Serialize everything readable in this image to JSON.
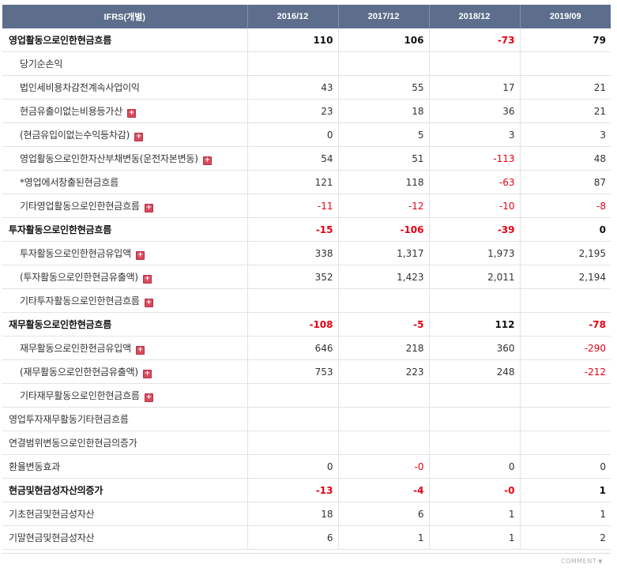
{
  "header": [
    "IFRS(개별)",
    "2016/12",
    "2017/12",
    "2018/12",
    "2019/09"
  ],
  "rows": [
    {
      "label": "영업활동으로인한현금흐름",
      "level": "major",
      "plus": false,
      "values": [
        "110",
        "106",
        "-73",
        "79"
      ]
    },
    {
      "label": "당기순손익",
      "level": "sub",
      "plus": false,
      "values": [
        "",
        "",
        "",
        ""
      ]
    },
    {
      "label": "법인세비용차감전계속사업이익",
      "level": "sub",
      "plus": false,
      "values": [
        "43",
        "55",
        "17",
        "21"
      ]
    },
    {
      "label": "현금유출이없는비용등가산",
      "level": "sub",
      "plus": true,
      "values": [
        "23",
        "18",
        "36",
        "21"
      ]
    },
    {
      "label": "(현금유입이없는수익등차감)",
      "level": "sub",
      "plus": true,
      "values": [
        "0",
        "5",
        "3",
        "3"
      ]
    },
    {
      "label": "영업활동으로인한자산부채변동(운전자본변동)",
      "level": "sub",
      "plus": true,
      "values": [
        "54",
        "51",
        "-113",
        "48"
      ]
    },
    {
      "label": "*영업에서창출된현금흐름",
      "level": "sub",
      "plus": false,
      "values": [
        "121",
        "118",
        "-63",
        "87"
      ]
    },
    {
      "label": "기타영업활동으로인한현금흐름",
      "level": "sub",
      "plus": true,
      "values": [
        "-11",
        "-12",
        "-10",
        "-8"
      ]
    },
    {
      "label": "투자활동으로인한현금흐름",
      "level": "major",
      "plus": false,
      "values": [
        "-15",
        "-106",
        "-39",
        "0"
      ]
    },
    {
      "label": "투자활동으로인한현금유입액",
      "level": "sub",
      "plus": true,
      "values": [
        "338",
        "1,317",
        "1,973",
        "2,195"
      ]
    },
    {
      "label": "(투자활동으로인한현금유출액)",
      "level": "sub",
      "plus": true,
      "values": [
        "352",
        "1,423",
        "2,011",
        "2,194"
      ]
    },
    {
      "label": "기타투자활동으로인한현금흐름",
      "level": "sub",
      "plus": true,
      "values": [
        "",
        "",
        "",
        ""
      ]
    },
    {
      "label": "재무활동으로인한현금흐름",
      "level": "major",
      "plus": false,
      "values": [
        "-108",
        "-5",
        "112",
        "-78"
      ]
    },
    {
      "label": "재무활동으로인한현금유입액",
      "level": "sub",
      "plus": true,
      "values": [
        "646",
        "218",
        "360",
        "-290"
      ]
    },
    {
      "label": "(재무활동으로인한현금유출액)",
      "level": "sub",
      "plus": true,
      "values": [
        "753",
        "223",
        "248",
        "-212"
      ]
    },
    {
      "label": "기타재무활동으로인한현금흐름",
      "level": "sub",
      "plus": true,
      "values": [
        "",
        "",
        "",
        ""
      ]
    },
    {
      "label": "영업투자재무활동기타현금흐름",
      "level": "top",
      "plus": false,
      "values": [
        "",
        "",
        "",
        ""
      ]
    },
    {
      "label": "연결범위변동으로인한현금의증가",
      "level": "top",
      "plus": false,
      "values": [
        "",
        "",
        "",
        ""
      ]
    },
    {
      "label": "환율변동효과",
      "level": "top",
      "plus": false,
      "values": [
        "0",
        "-0",
        "0",
        "0"
      ]
    },
    {
      "label": "현금및현금성자산의증가",
      "level": "major",
      "plus": false,
      "values": [
        "-13",
        "-4",
        "-0",
        "1"
      ]
    },
    {
      "label": "기초현금및현금성자산",
      "level": "top",
      "plus": false,
      "values": [
        "18",
        "6",
        "1",
        "1"
      ]
    },
    {
      "label": "기말현금및현금성자산",
      "level": "top",
      "plus": false,
      "values": [
        "6",
        "1",
        "1",
        "2"
      ]
    }
  ],
  "footer": {
    "comment_label": "COMMENT",
    "comment_icon": "triangle-down-icon"
  },
  "colors": {
    "header_bg": "#5d6e8c",
    "negative": "#e60012",
    "plus_icon": "#d94a5c"
  }
}
